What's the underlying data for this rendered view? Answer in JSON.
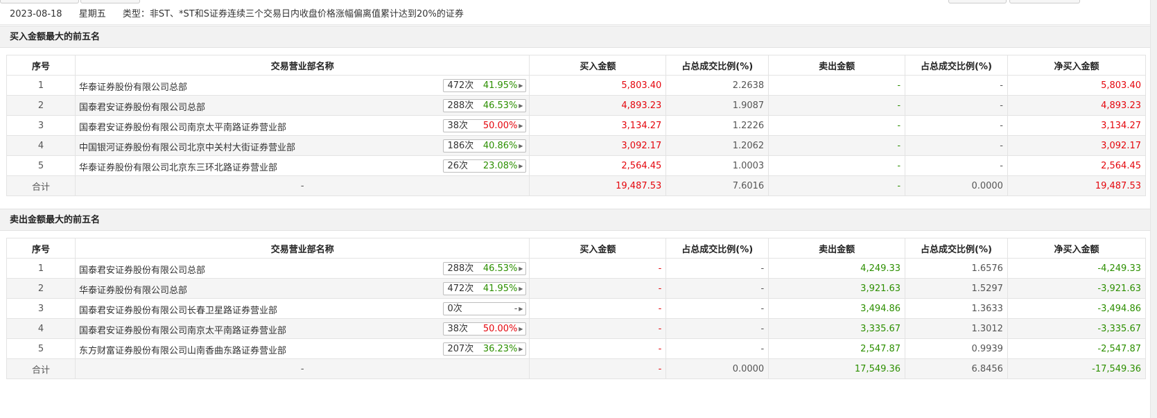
{
  "info": {
    "date": "2023-08-18",
    "weekday": "星期五",
    "type": "类型：非ST、*ST和S证券连续三个交易日内收盘价格涨幅偏离值累计达到20%的证券"
  },
  "colors": {
    "up": "#e4060d",
    "down": "#2c8f00",
    "stripe": "#f5f5f5"
  },
  "headers": [
    "序号",
    "交易营业部名称",
    "买入金额",
    "占总成交比例(%)",
    "卖出金额",
    "占总成交比例(%)",
    "净买入金额"
  ],
  "buy_section": {
    "title": "买入金额最大的前五名",
    "rows": [
      {
        "idx": "1",
        "name": "华泰证券股份有限公司总部",
        "times": "472次",
        "rate": "41.95%",
        "buy": "5,803.40",
        "buy_pct": "2.2638",
        "sell": "-",
        "sell_pct": "-",
        "net": "5,803.40"
      },
      {
        "idx": "2",
        "name": "国泰君安证券股份有限公司总部",
        "times": "288次",
        "rate": "46.53%",
        "buy": "4,893.23",
        "buy_pct": "1.9087",
        "sell": "-",
        "sell_pct": "-",
        "net": "4,893.23"
      },
      {
        "idx": "3",
        "name": "国泰君安证券股份有限公司南京太平南路证券营业部",
        "times": "38次",
        "rate": "50.00%",
        "buy": "3,134.27",
        "buy_pct": "1.2226",
        "sell": "-",
        "sell_pct": "-",
        "net": "3,134.27"
      },
      {
        "idx": "4",
        "name": "中国银河证券股份有限公司北京中关村大街证券营业部",
        "times": "186次",
        "rate": "40.86%",
        "buy": "3,092.17",
        "buy_pct": "1.2062",
        "sell": "-",
        "sell_pct": "-",
        "net": "3,092.17"
      },
      {
        "idx": "5",
        "name": "华泰证券股份有限公司北京东三环北路证券营业部",
        "times": "26次",
        "rate": "23.08%",
        "buy": "2,564.45",
        "buy_pct": "1.0003",
        "sell": "-",
        "sell_pct": "-",
        "net": "2,564.45"
      }
    ],
    "total": {
      "label": "合计",
      "name": "-",
      "buy": "19,487.53",
      "buy_pct": "7.6016",
      "sell": "-",
      "sell_pct": "0.0000",
      "net": "19,487.53"
    }
  },
  "sell_section": {
    "title": "卖出金额最大的前五名",
    "rows": [
      {
        "idx": "1",
        "name": "国泰君安证券股份有限公司总部",
        "times": "288次",
        "rate": "46.53%",
        "buy": "-",
        "buy_pct": "-",
        "sell": "4,249.33",
        "sell_pct": "1.6576",
        "net": "-4,249.33"
      },
      {
        "idx": "2",
        "name": "华泰证券股份有限公司总部",
        "times": "472次",
        "rate": "41.95%",
        "buy": "-",
        "buy_pct": "-",
        "sell": "3,921.63",
        "sell_pct": "1.5297",
        "net": "-3,921.63"
      },
      {
        "idx": "3",
        "name": "国泰君安证券股份有限公司长春卫星路证券营业部",
        "times": "0次",
        "rate": "-",
        "buy": "-",
        "buy_pct": "-",
        "sell": "3,494.86",
        "sell_pct": "1.3633",
        "net": "-3,494.86"
      },
      {
        "idx": "4",
        "name": "国泰君安证券股份有限公司南京太平南路证券营业部",
        "times": "38次",
        "rate": "50.00%",
        "buy": "-",
        "buy_pct": "-",
        "sell": "3,335.67",
        "sell_pct": "1.3012",
        "net": "-3,335.67"
      },
      {
        "idx": "5",
        "name": "东方财富证券股份有限公司山南香曲东路证券营业部",
        "times": "207次",
        "rate": "36.23%",
        "buy": "-",
        "buy_pct": "-",
        "sell": "2,547.87",
        "sell_pct": "0.9939",
        "net": "-2,547.87"
      }
    ],
    "total": {
      "label": "合计",
      "name": "-",
      "buy": "-",
      "buy_pct": "0.0000",
      "sell": "17,549.36",
      "sell_pct": "6.8456",
      "net": "-17,549.36"
    }
  }
}
